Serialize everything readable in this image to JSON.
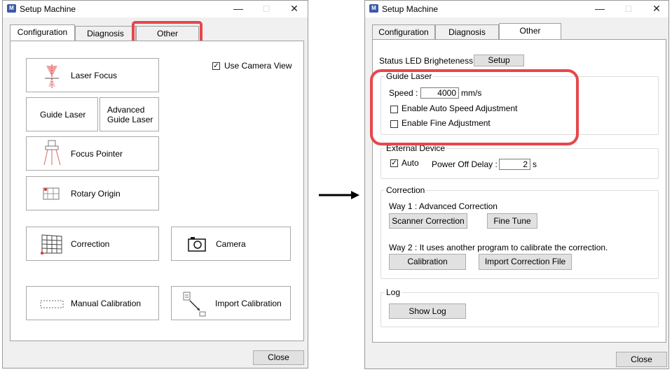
{
  "left_window": {
    "title": "Setup Machine",
    "app_icon_text": "M",
    "tabs": [
      "Configuration",
      "Diagnosis",
      "Other"
    ],
    "buttons": {
      "laser_focus": "Laser Focus",
      "guide_laser": "Guide Laser",
      "advanced_guide_laser_1": "Advanced",
      "advanced_guide_laser_2": "Guide Laser",
      "focus_pointer": "Focus Pointer",
      "rotary_origin": "Rotary Origin",
      "correction": "Correction",
      "camera": "Camera",
      "manual_calibration": "Manual Calibration",
      "import_calibration": "Import Calibration"
    },
    "use_camera_view": {
      "label": "Use Camera View",
      "checked": true
    },
    "close_label": "Close"
  },
  "right_window": {
    "title": "Setup Machine",
    "app_icon_text": "M",
    "tabs": [
      "Configuration",
      "Diagnosis",
      "Other"
    ],
    "status_led": {
      "label": "Status LED Brigheteness :",
      "button": "Setup"
    },
    "guide_laser": {
      "title": "Guide Laser",
      "speed_label": "Speed :",
      "speed_value": "4000",
      "speed_unit": "mm/s",
      "auto_speed_label": "Enable Auto Speed Adjustment",
      "fine_adjust_label": "Enable Fine Adjustment"
    },
    "external_device": {
      "title": "External Device",
      "auto_label": "Auto",
      "power_off_label": "Power Off Delay :",
      "power_off_value": "2",
      "power_off_unit": "s"
    },
    "correction": {
      "title": "Correction",
      "way1": "Way 1 : Advanced Correction",
      "scanner_correction": "Scanner Correction",
      "fine_tune": "Fine Tune",
      "way2": "Way 2 : It uses another program to calibrate the correction.",
      "calibration": "Calibration",
      "import_correction_file": "Import Correction File"
    },
    "log": {
      "title": "Log",
      "show_log": "Show Log"
    },
    "close_label": "Close"
  },
  "colors": {
    "highlight": "#e8464b",
    "window_bg": "#f0f0f0",
    "panel_bg": "#ffffff"
  }
}
